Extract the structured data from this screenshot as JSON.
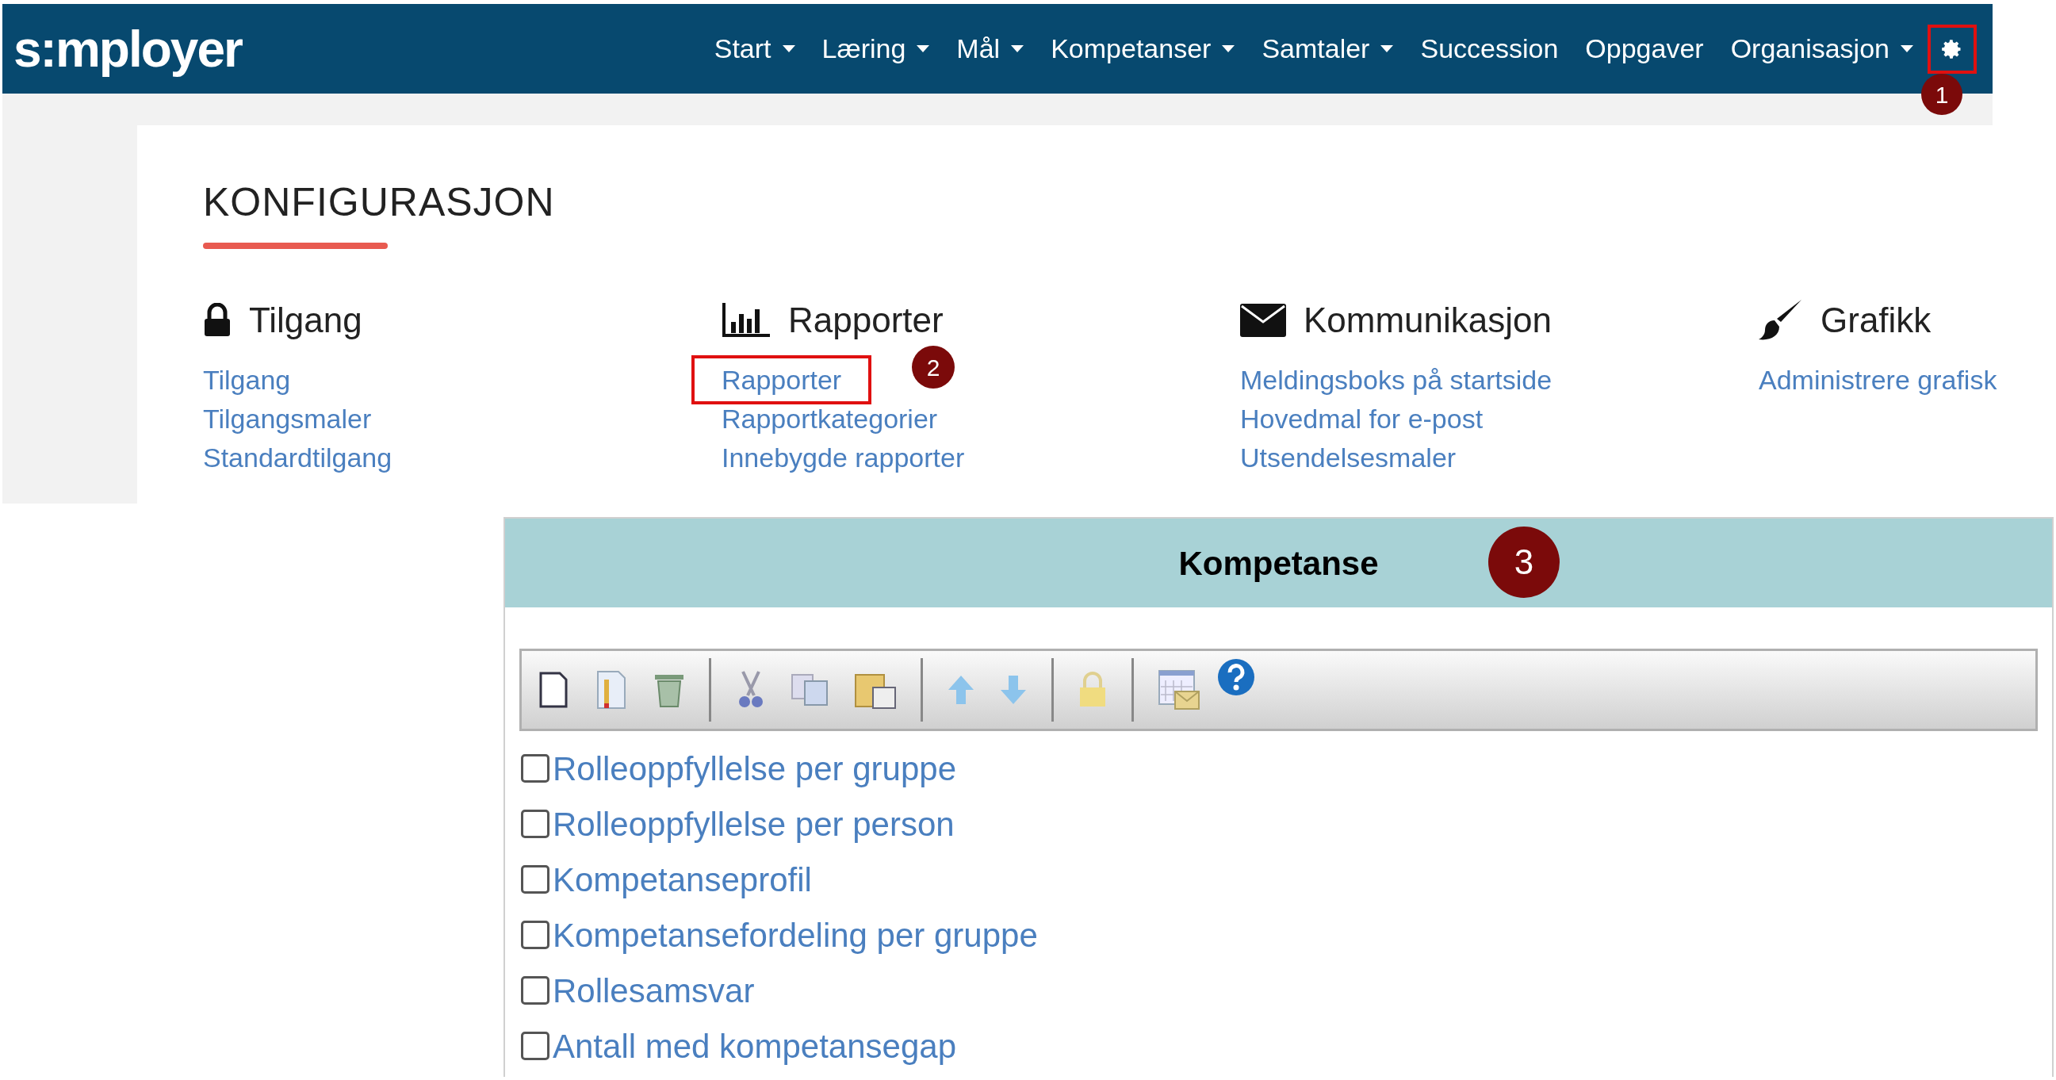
{
  "header": {
    "logo": "s:mployer",
    "nav": [
      {
        "label": "Start",
        "kind": "dropdown"
      },
      {
        "label": "Læring",
        "kind": "dropdown"
      },
      {
        "label": "Mål",
        "kind": "dropdown"
      },
      {
        "label": "Kompetanser",
        "kind": "dropdown"
      },
      {
        "label": "Samtaler",
        "kind": "dropdown"
      },
      {
        "label": "Succession",
        "kind": "link"
      },
      {
        "label": "Oppgaver",
        "kind": "link"
      },
      {
        "label": "Organisasjon",
        "kind": "dropdown"
      }
    ],
    "settings": {
      "highlighted": true,
      "callout": "1"
    }
  },
  "config": {
    "title": "KONFIGURASJON",
    "sections": [
      {
        "kind": "lock",
        "title": "Tilgang",
        "links": [
          {
            "label": "Tilgang",
            "highlighted": false
          },
          {
            "label": "Tilgangsmaler",
            "highlighted": false
          },
          {
            "label": "Standardtilgang",
            "highlighted": false
          }
        ]
      },
      {
        "kind": "chart",
        "title": "Rapporter",
        "links": [
          {
            "label": "Rapporter",
            "highlighted": true,
            "callout": "2"
          },
          {
            "label": "Rapportkategorier",
            "highlighted": false
          },
          {
            "label": "Innebygde rapporter",
            "highlighted": false
          }
        ]
      },
      {
        "kind": "envelope",
        "title": "Kommunikasjon",
        "links": [
          {
            "label": "Meldingsboks på startside",
            "highlighted": false
          },
          {
            "label": "Hovedmal for e-post",
            "highlighted": false
          },
          {
            "label": "Utsendelsesmaler",
            "highlighted": false
          }
        ]
      },
      {
        "kind": "brush",
        "title": "Grafikk",
        "links": [
          {
            "label": "Administrere grafisk",
            "highlighted": false
          }
        ]
      }
    ]
  },
  "reports": {
    "title": "Kompetanse",
    "callout": "3",
    "items": [
      {
        "label": "Rolleoppfyllelse per gruppe",
        "checked": false
      },
      {
        "label": "Rolleoppfyllelse per person",
        "checked": false
      },
      {
        "label": "Kompetanseprofil",
        "checked": false
      },
      {
        "label": "Kompetansefordeling per gruppe",
        "checked": false
      },
      {
        "label": "Rollesamsvar",
        "checked": false
      },
      {
        "label": "Antall med kompetansegap",
        "checked": false
      }
    ]
  }
}
